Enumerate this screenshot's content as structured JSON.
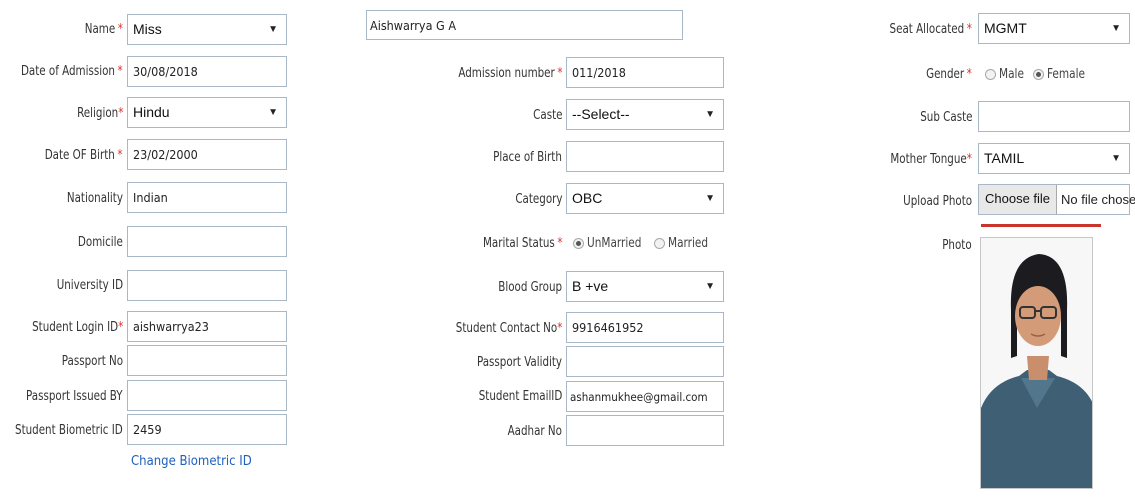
{
  "left": {
    "name": {
      "label": "Name",
      "value": "Miss"
    },
    "date_of_admission": {
      "label": "Date of Admission",
      "value": "30/08/2018"
    },
    "religion": {
      "label": "Religion",
      "value": "Hindu"
    },
    "date_of_birth": {
      "label": "Date OF Birth",
      "value": "23/02/2000"
    },
    "nationality": {
      "label": "Nationality",
      "value": "Indian"
    },
    "domicile": {
      "label": "Domicile",
      "value": ""
    },
    "university_id": {
      "label": "University ID",
      "value": ""
    },
    "student_login_id": {
      "label": "Student Login ID",
      "value": "aishwarrya23"
    },
    "passport_no": {
      "label": "Passport No",
      "value": ""
    },
    "passport_issued_by": {
      "label": "Passport Issued BY",
      "value": ""
    },
    "student_biometric_id": {
      "label": "Student Biometric ID",
      "value": "2459"
    },
    "change_biometric_link": "Change Biometric ID"
  },
  "middle": {
    "full_name_value": "Aishwarrya G A",
    "admission_number": {
      "label": "Admission number",
      "value": "011/2018"
    },
    "caste": {
      "label": "Caste",
      "value": "--Select--"
    },
    "place_of_birth": {
      "label": "Place of Birth",
      "value": ""
    },
    "category": {
      "label": "Category",
      "value": "OBC"
    },
    "marital_status": {
      "label": "Marital Status",
      "options": [
        "UnMarried",
        "Married"
      ],
      "selected": "UnMarried"
    },
    "blood_group": {
      "label": "Blood Group",
      "value": "B +ve"
    },
    "student_contact_no": {
      "label": "Student Contact No",
      "value": "9916461952"
    },
    "passport_validity": {
      "label": "Passport Validity",
      "value": ""
    },
    "student_email": {
      "label": "Student EmailID",
      "value": "ashanmukhee@gmail.com"
    },
    "aadhar_no": {
      "label": "Aadhar No",
      "value": ""
    }
  },
  "right": {
    "seat_allocated": {
      "label": "Seat Allocated",
      "value": "MGMT"
    },
    "gender": {
      "label": "Gender",
      "options": [
        "Male",
        "Female"
      ],
      "selected": "Female"
    },
    "sub_caste": {
      "label": "Sub Caste",
      "value": ""
    },
    "mother_tongue": {
      "label": "Mother Tongue",
      "value": "TAMIL"
    },
    "upload_photo": {
      "label": "Upload Photo",
      "button": "Choose file",
      "status": "No file chosen"
    },
    "photo_label": "Photo"
  },
  "required_marker": "*",
  "dropdown_arrow": "▼",
  "colors": {
    "required": "#d9322b",
    "link": "#1f5fbd",
    "field_border": "#a9b8c6",
    "underline": "#c9342c"
  }
}
